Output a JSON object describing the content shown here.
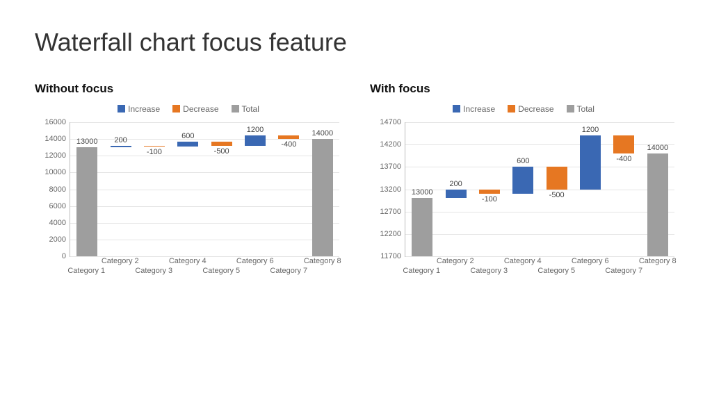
{
  "page_title": "Waterfall chart focus feature",
  "legend": {
    "increase": "Increase",
    "decrease": "Decrease",
    "total": "Total"
  },
  "colors": {
    "increase": "#3a68b3",
    "decrease": "#e67722",
    "total": "#9e9e9e"
  },
  "charts": {
    "left": {
      "title": "Without focus"
    },
    "right": {
      "title": "With focus"
    }
  },
  "chart_data": [
    {
      "id": "without_focus",
      "type": "bar",
      "subtype": "waterfall",
      "title": "Without focus",
      "categories": [
        "Category 1",
        "Category 2",
        "Category 3",
        "Category 4",
        "Category 5",
        "Category 6",
        "Category 7",
        "Category 8"
      ],
      "series": [
        {
          "name": "Total",
          "indices": [
            0,
            7
          ],
          "values": [
            13000,
            14000
          ]
        },
        {
          "name": "Increase",
          "indices": [
            1,
            3,
            5
          ],
          "values": [
            200,
            600,
            1200
          ]
        },
        {
          "name": "Decrease",
          "indices": [
            2,
            4,
            6
          ],
          "values": [
            -100,
            -500,
            -400
          ]
        }
      ],
      "data_labels": [
        13000,
        200,
        -100,
        600,
        -500,
        1200,
        -400,
        14000
      ],
      "ylim": [
        0,
        16000
      ],
      "ytick_step": 2000,
      "xlabel": "",
      "ylabel": ""
    },
    {
      "id": "with_focus",
      "type": "bar",
      "subtype": "waterfall",
      "title": "With focus",
      "categories": [
        "Category 1",
        "Category 2",
        "Category 3",
        "Category 4",
        "Category 5",
        "Category 6",
        "Category 7",
        "Category 8"
      ],
      "series": [
        {
          "name": "Total",
          "indices": [
            0,
            7
          ],
          "values": [
            13000,
            14000
          ]
        },
        {
          "name": "Increase",
          "indices": [
            1,
            3,
            5
          ],
          "values": [
            200,
            600,
            1200
          ]
        },
        {
          "name": "Decrease",
          "indices": [
            2,
            4,
            6
          ],
          "values": [
            -100,
            -500,
            -400
          ]
        }
      ],
      "data_labels": [
        13000,
        200,
        -100,
        600,
        -500,
        1200,
        -400,
        14000
      ],
      "ylim": [
        11700,
        14700
      ],
      "ytick_step": 500,
      "xlabel": "",
      "ylabel": ""
    }
  ]
}
